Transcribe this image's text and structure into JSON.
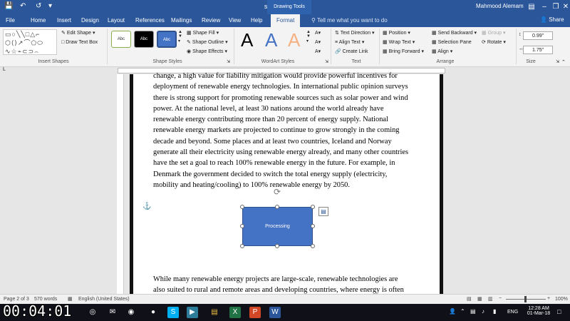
{
  "window": {
    "title": "sample - Word",
    "contextual_group": "Drawing Tools",
    "user": "Mahmood Alemam"
  },
  "tabs": [
    "File",
    "Home",
    "Insert",
    "Design",
    "Layout",
    "References",
    "Mailings",
    "Review",
    "View",
    "Help",
    "Format"
  ],
  "active_tab": "Format",
  "tell_me": "Tell me what you want to do",
  "share": "Share",
  "ribbon": {
    "insert_shapes": {
      "label": "Insert Shapes",
      "edit_shape": "Edit Shape",
      "draw_text_box": "Draw Text Box"
    },
    "shape_styles": {
      "label": "Shape Styles",
      "swatch_text": "Abc",
      "fill": "Shape Fill",
      "outline": "Shape Outline",
      "effects": "Shape Effects"
    },
    "wordart": {
      "label": "WordArt Styles",
      "letter": "A"
    },
    "text": {
      "label": "Text",
      "direction": "Text Direction",
      "align": "Align Text",
      "link": "Create Link"
    },
    "arrange": {
      "label": "Arrange",
      "position": "Position",
      "wrap": "Wrap Text",
      "forward": "Bring Forward",
      "backward": "Send Backward",
      "pane": "Selection Pane",
      "align": "Align",
      "group": "Group",
      "rotate": "Rotate"
    },
    "size": {
      "label": "Size",
      "height": "0.99\"",
      "width": "1.75\""
    }
  },
  "document": {
    "para1_lines": [
      "change, a high value for liability mitigation would provide powerful incentives for",
      "deployment of renewable energy technologies. In international public opinion surveys",
      "there is strong support for promoting renewable sources such as solar power and wind",
      "power. At the national level, at least 30 nations around the world already have",
      "renewable energy contributing more than 20 percent of energy supply. National",
      "renewable energy markets are projected to continue to grow strongly in the coming",
      "decade and beyond. Some places and at least two countries, Iceland and Norway",
      "generate all their electricity using renewable energy already, and many other countries",
      "have the set a goal to reach 100% renewable energy in the future. For example, in",
      "Denmark the government decided to switch the total energy supply (electricity,",
      "mobility and heating/cooling) to 100% renewable energy by 2050."
    ],
    "shape_text": "Processing",
    "para2_lines": [
      "While many renewable energy projects are large-scale, renewable technologies are",
      "also suited to rural and remote areas and developing countries, where energy is often"
    ]
  },
  "status": {
    "page": "Page 2 of 3",
    "words": "570 words",
    "language": "English (United States)",
    "zoom": "100%"
  },
  "taskbar": {
    "lang": "ENG",
    "time": "12:28 AM",
    "date": "01-Mar-18"
  },
  "overlay_timer": "00:04:01"
}
